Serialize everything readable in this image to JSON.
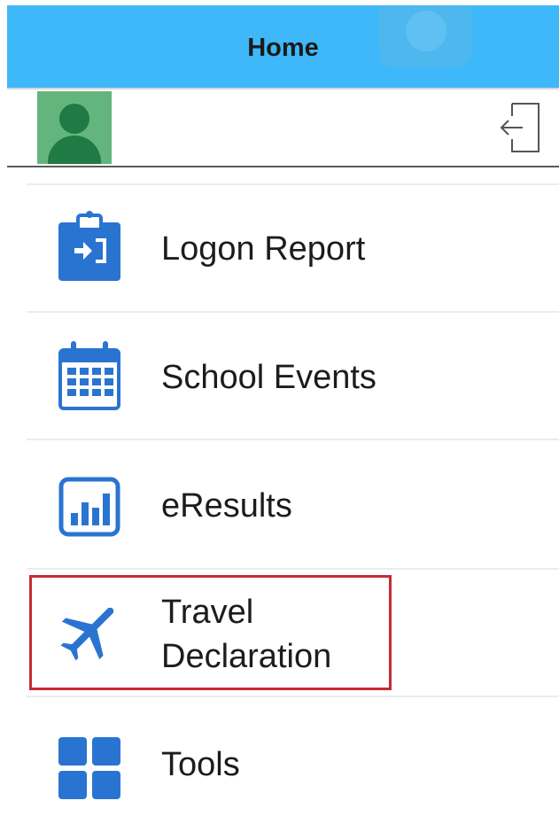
{
  "header": {
    "title": "Home",
    "background_color": "#3fb8f9"
  },
  "profile": {
    "avatar_icon": "user-avatar-icon",
    "logout_icon": "logout-icon"
  },
  "menu": {
    "items": [
      {
        "label": "Logon Report",
        "icon": "clipboard-login-icon"
      },
      {
        "label": "School Events",
        "icon": "calendar-icon"
      },
      {
        "label": "eResults",
        "icon": "bar-chart-icon"
      },
      {
        "label": "Travel Declaration",
        "label_line1": "Travel",
        "label_line2": "Declaration",
        "icon": "airplane-icon",
        "highlighted": true
      },
      {
        "label": "Tools",
        "icon": "grid-tiles-icon"
      }
    ],
    "accent_color": "#2a74d1",
    "highlight_color": "#c62b35"
  }
}
